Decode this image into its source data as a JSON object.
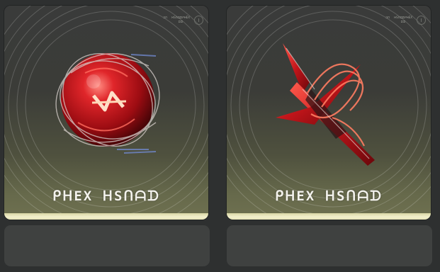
{
  "cards": [
    {
      "label": "ᑭᕼEX ᕼSᑎᗩᗪ",
      "meta": [
        "ᑐᑎ",
        "ᕼSᑎᗩᗪᑭᕼEX"
      ],
      "meta_sub": "ᗪᗪ",
      "art": "red-sphere-emblem",
      "accent": "#c8161b"
    },
    {
      "label": "ᑭᕼEX ᕼSᑎᗩᗪ",
      "meta": [
        "ᑐᑎ",
        "ᕼSᑎᗩᗪᑭᕼEX"
      ],
      "meta_sub": "ᗪᗪ",
      "art": "red-cross-emblem",
      "accent": "#c8161b"
    }
  ],
  "colors": {
    "background": "#2e3030",
    "card_bar": "#efecc6",
    "slot": "#3f4140"
  }
}
